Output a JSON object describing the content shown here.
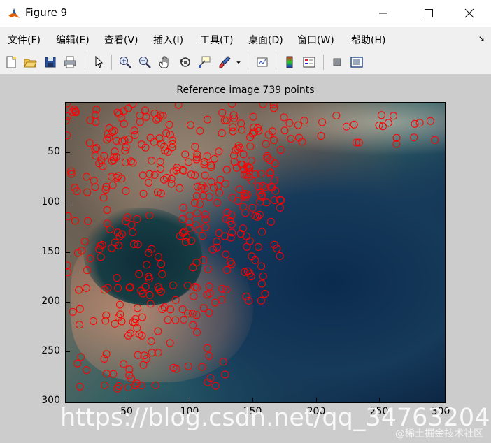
{
  "window": {
    "title": "Figure 9"
  },
  "menu": [
    "文件(F)",
    "编辑(E)",
    "查看(V)",
    "插入(I)",
    "工具(T)",
    "桌面(D)",
    "窗口(W)",
    "帮助(H)"
  ],
  "toolbar": {
    "icons": [
      "new-file-icon",
      "open-folder-icon",
      "save-icon",
      "print-icon",
      "pointer-icon",
      "zoom-in-icon",
      "zoom-out-icon",
      "pan-hand-icon",
      "rotate-3d-icon",
      "data-cursor-icon",
      "brush-icon",
      "brush-dropdown-icon",
      "link-plot-icon",
      "colorbar-icon",
      "legend-icon",
      "hide-plot-tools-icon",
      "show-plot-tools-icon"
    ]
  },
  "axes": {
    "title": "Reference image 739 points",
    "xticks": [
      "50",
      "100",
      "150",
      "200",
      "250",
      "300"
    ],
    "yticks": [
      "50",
      "100",
      "150",
      "200",
      "250",
      "300"
    ],
    "marker_color": "#ff0000"
  },
  "watermark": {
    "main": "https://blog.csdn.net/qq_34763204",
    "corner": "@稀土掘金技术社区"
  }
}
